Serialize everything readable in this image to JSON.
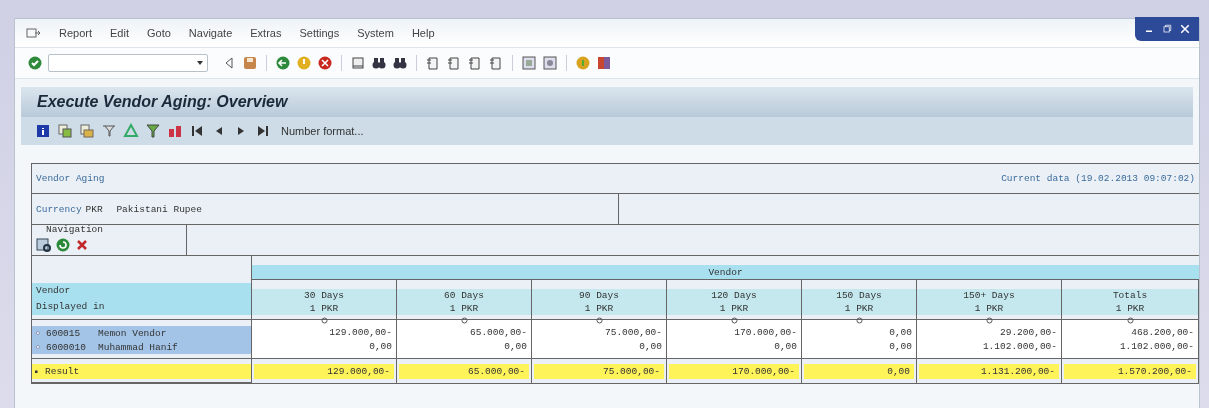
{
  "menu_bar": [
    "Report",
    "Edit",
    "Goto",
    "Navigate",
    "Extras",
    "Settings",
    "System",
    "Help"
  ],
  "screen_title": "Execute Vendor Aging: Overview",
  "app_toolbar": {
    "number_format_button": "Number format..."
  },
  "report": {
    "title": "Vendor Aging",
    "timestamp": "Current data (19.02.2013 09:07:02)",
    "currency_label": "Currency",
    "currency_code": "PKR",
    "currency_name": "Pakistani Rupee",
    "navigation_label": "Navigation",
    "group_header": "Vendor",
    "row_header": [
      "Vendor",
      "Displayed in"
    ],
    "columns": [
      {
        "title": "30 Days",
        "unit": "1 PKR"
      },
      {
        "title": "60 Days",
        "unit": "1 PKR"
      },
      {
        "title": "90 Days",
        "unit": "1 PKR"
      },
      {
        "title": "120 Days",
        "unit": "1 PKR"
      },
      {
        "title": "150 Days",
        "unit": "1 PKR"
      },
      {
        "title": "150+ Days",
        "unit": "1 PKR"
      },
      {
        "title": "Totals",
        "unit": "1 PKR"
      }
    ],
    "rows": [
      {
        "id": "600015",
        "name": "Memon Vendor",
        "values": [
          "129.000,00-",
          "65.000,00-",
          "75.000,00-",
          "170.000,00-",
          "0,00",
          "29.200,00-",
          "468.200,00-"
        ]
      },
      {
        "id": "6000010",
        "name": "Muhammad Hanif",
        "values": [
          "0,00",
          "0,00",
          "0,00",
          "0,00",
          "0,00",
          "1.102.000,00-",
          "1.102.000,00-"
        ]
      }
    ],
    "result": {
      "label": "Result",
      "values": [
        "129.000,00-",
        "65.000,00-",
        "75.000,00-",
        "170.000,00-",
        "0,00",
        "1.131.200,00-",
        "1.570.200,00-"
      ]
    }
  }
}
